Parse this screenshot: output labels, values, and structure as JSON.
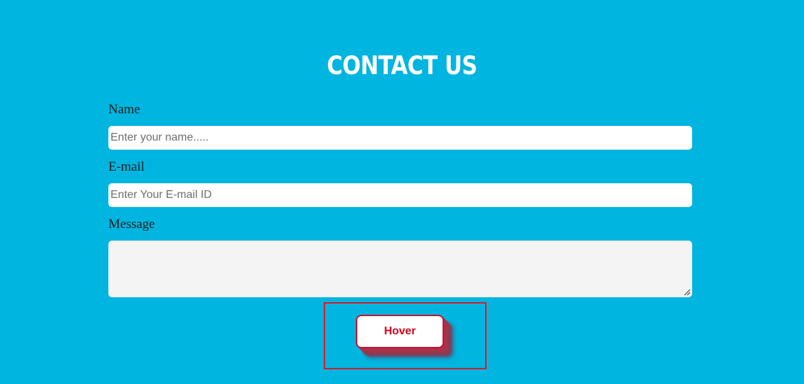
{
  "page": {
    "title": "CONTACT US",
    "background_color": "#00b5df"
  },
  "form": {
    "name": {
      "label": "Name",
      "placeholder": "Enter your name.....",
      "value": ""
    },
    "email": {
      "label": "E-mail",
      "placeholder": "Enter Your E-mail ID",
      "value": ""
    },
    "message": {
      "label": "Message",
      "value": ""
    },
    "submit": {
      "label": "Hover",
      "text_color": "#d0021b",
      "border_color": "#c8102e"
    }
  },
  "highlight": {
    "border_color": "#d41c2c"
  }
}
